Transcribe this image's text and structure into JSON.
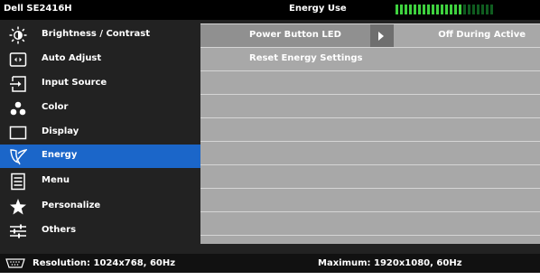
{
  "header": {
    "model": "Dell SE2416H",
    "section_title": "Energy Use",
    "energy_meter_icon": "energy-use-meter",
    "energy_meter_colors": {
      "on": "#3fd23f",
      "off": "#0f5c1f"
    }
  },
  "sidebar": {
    "items": [
      {
        "label": "Brightness / Contrast",
        "icon": "brightness-icon"
      },
      {
        "label": "Auto Adjust",
        "icon": "auto-adjust-icon"
      },
      {
        "label": "Input Source",
        "icon": "input-source-icon"
      },
      {
        "label": "Color",
        "icon": "color-icon"
      },
      {
        "label": "Display",
        "icon": "display-icon"
      },
      {
        "label": "Energy",
        "icon": "energy-leaf-icon",
        "active": true
      },
      {
        "label": "Menu",
        "icon": "menu-icon"
      },
      {
        "label": "Personalize",
        "icon": "star-icon"
      },
      {
        "label": "Others",
        "icon": "others-sliders-icon"
      }
    ],
    "active_color": "#1b66c9"
  },
  "panel": {
    "rows": [
      {
        "label": "Power Button LED",
        "value": "Off During Active",
        "arrow_icon": "arrow-right-icon"
      },
      {
        "label": "Reset Energy Settings"
      }
    ]
  },
  "status": {
    "resolution_icon": "vga-connector-icon",
    "resolution": "Resolution: 1024x768, 60Hz",
    "maximum": "Maximum: 1920x1080, 60Hz"
  }
}
